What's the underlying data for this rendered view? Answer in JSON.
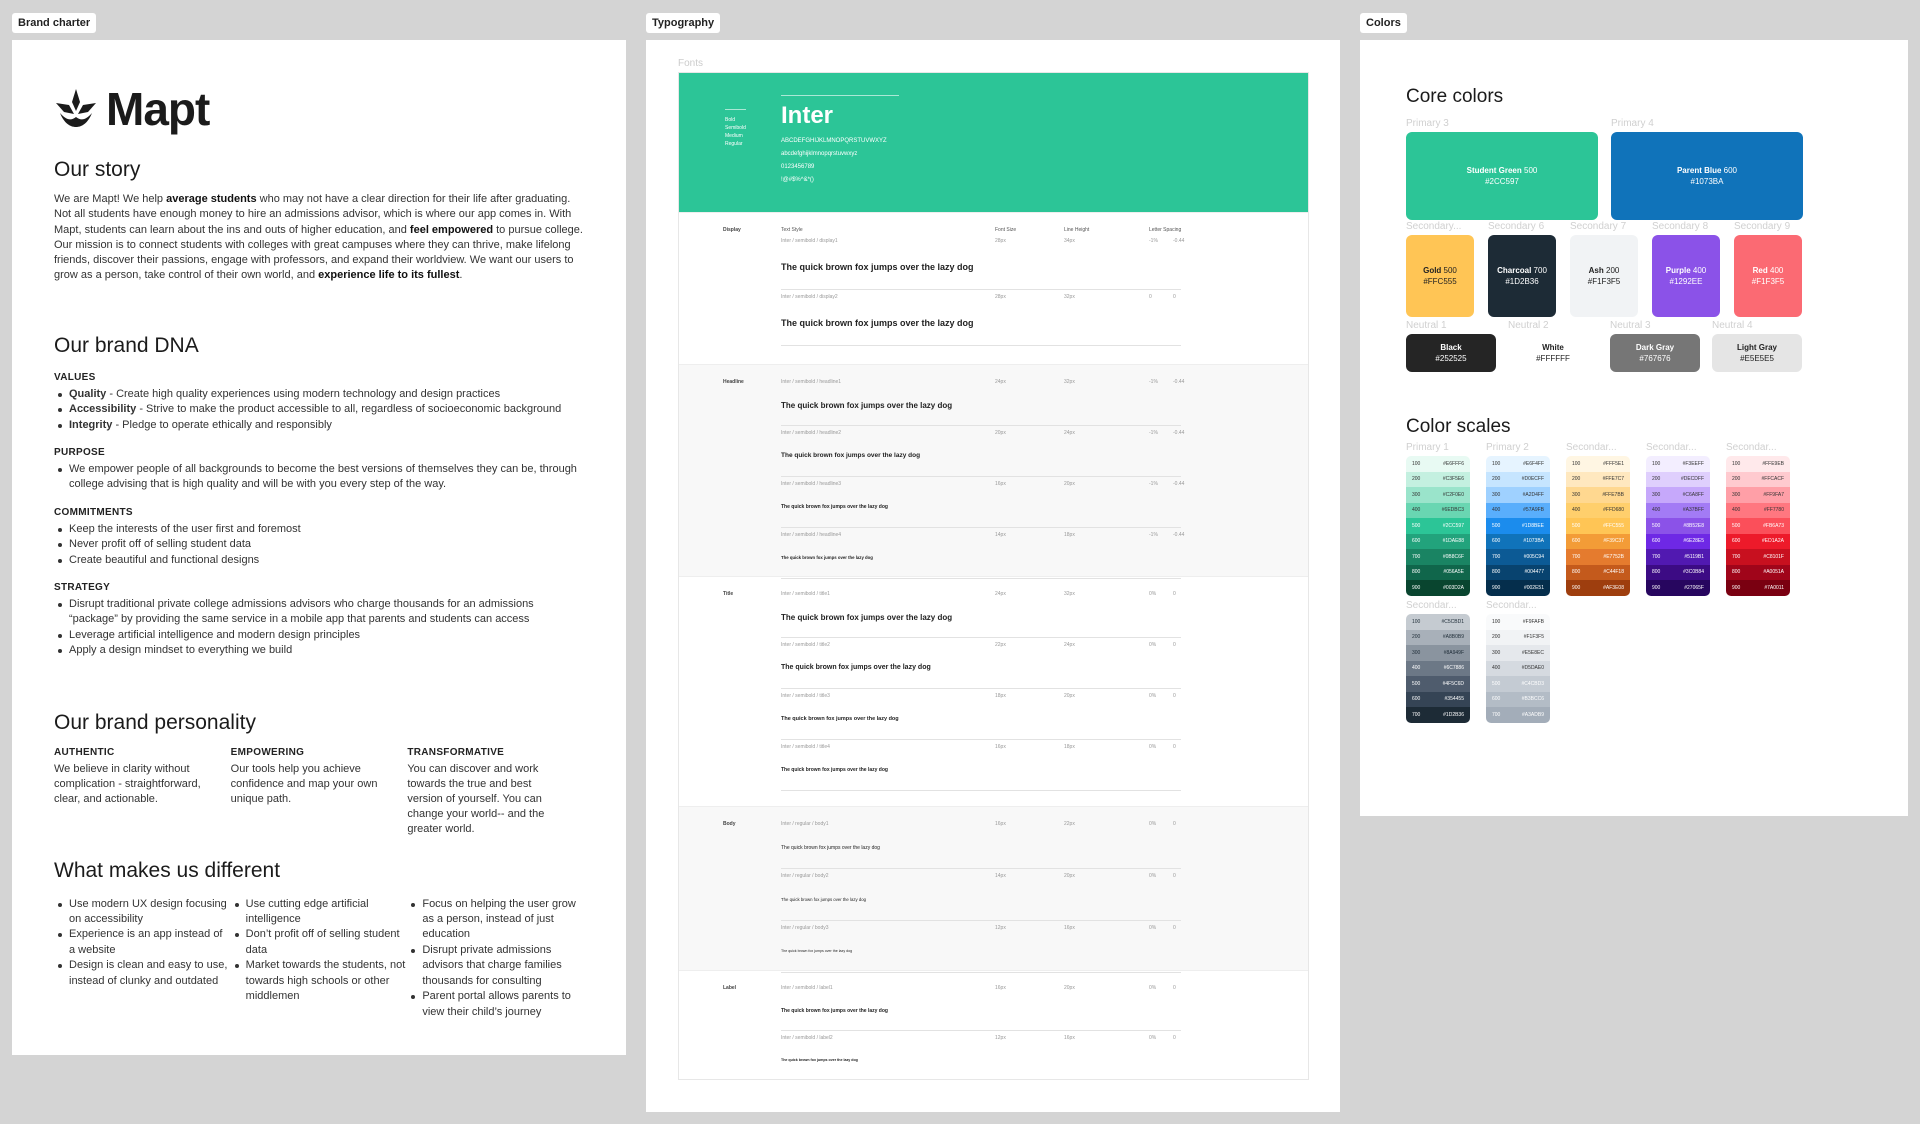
{
  "frames": {
    "brand": "Brand charter",
    "typography": "Typography",
    "colors": "Colors"
  },
  "brand": {
    "logo_text": "Mapt",
    "story_title": "Our story",
    "story_parts": [
      {
        "t": "We are Mapt! We help "
      },
      {
        "t": "average students",
        "b": true
      },
      {
        "t": " who may not have a clear direction for their life after graduating. Not all students have enough money to hire an admissions advisor, which is where our app comes in. With Mapt, students can learn about the ins and outs of higher education, and "
      },
      {
        "t": "feel empowered",
        "b": true
      },
      {
        "t": " to pursue college. Our mission is to connect students with colleges with great campuses where they can thrive, make lifelong friends, discover their passions, engage with professors, and expand their worldview. We want our users to grow as a person, take control of their own world, and "
      },
      {
        "t": "experience life to its fullest",
        "b": true
      },
      {
        "t": "."
      }
    ],
    "dna_title": "Our brand DNA",
    "values_title": "VALUES",
    "values": [
      {
        "k": "Quality",
        "v": " - Create high quality experiences using modern technology and design practices"
      },
      {
        "k": "Accessibility",
        "v": " - Strive to make the product accessible to all, regardless of socioeconomic background"
      },
      {
        "k": "Integrity",
        "v": " - Pledge to operate ethically and responsibly"
      }
    ],
    "purpose_title": "PURPOSE",
    "purpose": [
      "We empower people of all backgrounds to become the best versions of themselves they can be, through college advising that is high quality and will be with you every step of the way."
    ],
    "commit_title": "COMMITMENTS",
    "commitments": [
      "Keep the interests of the user first and foremost",
      "Never profit off of selling student data",
      "Create beautiful and functional designs"
    ],
    "strategy_title": "STRATEGY",
    "strategy": [
      "Disrupt traditional private college admissions advisors who charge thousands for an admissions “package” by providing the same service in a mobile app that parents and students can access",
      "Leverage artificial intelligence and modern design principles",
      "Apply a design mindset to everything we build"
    ],
    "personality_title": "Our brand personality",
    "personality": [
      {
        "h": "AUTHENTIC",
        "t": "We believe in clarity without complication - straightforward, clear, and actionable."
      },
      {
        "h": "EMPOWERING",
        "t": "Our tools help you achieve confidence and map your own unique path."
      },
      {
        "h": "TRANSFORMATIVE",
        "t": "You can discover and work towards the true and best version of yourself. You can change your world-- and the greater world."
      }
    ],
    "different_title": "What makes us different",
    "different": [
      [
        "Use modern UX design focusing on accessibility",
        "Experience is an app instead of a website",
        "Design is clean and easy to use, instead of clunky and outdated"
      ],
      [
        "Use cutting edge artificial intelligence",
        "Don’t profit off of selling student data",
        "Market towards the students, not towards high schools or other middlemen"
      ],
      [
        "Focus on helping the user grow as a person, instead of just education",
        "Disrupt private admissions advisors that charge families thousands for consulting",
        "Parent portal allows parents to view their child’s journey"
      ]
    ]
  },
  "typography": {
    "fonts_label": "Fonts",
    "weights": [
      "Bold",
      "Semibold",
      "Medium",
      "Regular"
    ],
    "font_name": "Inter",
    "glyphs": [
      "ABCDEFGHIJKLMNOPQRSTUVWXYZ",
      "abcdefghijklmnopqrstuvwxyz",
      "0123456789",
      "!@#$%^&*()"
    ],
    "columns": [
      "Text Style",
      "Font Size",
      "Line Height",
      "Letter Spacing"
    ],
    "sample": "The quick brown fox jumps over the lazy dog",
    "sections": [
      {
        "name": "Display",
        "rows": [
          {
            "style": "Inter / semibold / display1",
            "size": "28px",
            "lh": "34px",
            "ls": "-1%",
            "ls2": "-0.44"
          },
          {
            "style": "Inter / semibold / display2",
            "size": "28px",
            "lh": "32px",
            "ls": "0",
            "ls2": "0"
          }
        ]
      },
      {
        "name": "Headline",
        "rows": [
          {
            "style": "Inter / semibold / headline1",
            "size": "24px",
            "lh": "32px",
            "ls": "-1%",
            "ls2": "-0.44"
          },
          {
            "style": "Inter / semibold / headline2",
            "size": "20px",
            "lh": "24px",
            "ls": "-1%",
            "ls2": "-0.44"
          },
          {
            "style": "Inter / semibold / headline3",
            "size": "16px",
            "lh": "20px",
            "ls": "-1%",
            "ls2": "-0.44"
          },
          {
            "style": "Inter / semibold / headline4",
            "size": "14px",
            "lh": "18px",
            "ls": "-1%",
            "ls2": "-0.44"
          }
        ]
      },
      {
        "name": "Title",
        "rows": [
          {
            "style": "Inter / semibold / title1",
            "size": "24px",
            "lh": "32px",
            "ls": "0%",
            "ls2": "0"
          },
          {
            "style": "Inter / semibold / title2",
            "size": "22px",
            "lh": "24px",
            "ls": "0%",
            "ls2": "0"
          },
          {
            "style": "Inter / semibold / title3",
            "size": "18px",
            "lh": "20px",
            "ls": "0%",
            "ls2": "0"
          },
          {
            "style": "Inter / semibold / title4",
            "size": "16px",
            "lh": "18px",
            "ls": "0%",
            "ls2": "0"
          }
        ]
      },
      {
        "name": "Body",
        "rows": [
          {
            "style": "Inter / regular / body1",
            "size": "16px",
            "lh": "22px",
            "ls": "0%",
            "ls2": "0"
          },
          {
            "style": "Inter / regular / body2",
            "size": "14px",
            "lh": "20px",
            "ls": "0%",
            "ls2": "0"
          },
          {
            "style": "Inter / regular / body3",
            "size": "12px",
            "lh": "16px",
            "ls": "0%",
            "ls2": "0"
          }
        ]
      },
      {
        "name": "Label",
        "rows": [
          {
            "style": "Inter / semibold / label1",
            "size": "16px",
            "lh": "20px",
            "ls": "0%",
            "ls2": "0"
          },
          {
            "style": "Inter / semibold / label2",
            "size": "12px",
            "lh": "16px",
            "ls": "0%",
            "ls2": "0"
          }
        ]
      }
    ]
  },
  "colors": {
    "core_title": "Core colors",
    "primary": [
      {
        "label": "Primary 3",
        "name": "Student Green",
        "w": "500",
        "hex": "#2CC597",
        "bg": "#2cc597",
        "fg": "#ffffff"
      },
      {
        "label": "Primary 4",
        "name": "Parent Blue",
        "w": "600",
        "hex": "#1073BA",
        "bg": "#1073ba",
        "fg": "#ffffff"
      }
    ],
    "secondary": [
      {
        "label": "Secondary...",
        "name": "Gold",
        "w": "500",
        "hex": "#FFC555",
        "bg": "#ffc555",
        "fg": "#222222"
      },
      {
        "label": "Secondary 6",
        "name": "Charcoal",
        "w": "700",
        "hex": "#1D2B36",
        "bg": "#1d2b36",
        "fg": "#ffffff"
      },
      {
        "label": "Secondary 7",
        "name": "Ash",
        "w": "200",
        "hex": "#F1F3F5",
        "bg": "#f1f3f5",
        "fg": "#222222"
      },
      {
        "label": "Secondary 8",
        "name": "Purple",
        "w": "400",
        "hex": "#1292EE",
        "bg": "#8b52e8",
        "fg": "#ffffff"
      },
      {
        "label": "Secondary 9",
        "name": "Red",
        "w": "400",
        "hex": "#F1F3F5",
        "bg": "#fb6a73",
        "fg": "#ffffff"
      }
    ],
    "neutral": [
      {
        "label": "Neutral 1",
        "name": "Black",
        "hex": "#252525",
        "bg": "#252525",
        "fg": "#ffffff"
      },
      {
        "label": "Neutral 2",
        "name": "White",
        "hex": "#FFFFFF",
        "bg": "#ffffff",
        "fg": "#222222"
      },
      {
        "label": "Neutral 3",
        "name": "Dark Gray",
        "hex": "#767676",
        "bg": "#767676",
        "fg": "#ffffff"
      },
      {
        "label": "Neutral 4",
        "name": "Light Gray",
        "hex": "#E5E5E5",
        "bg": "#e5e5e5",
        "fg": "#222222"
      }
    ],
    "scales_title": "Color scales",
    "scales": [
      {
        "label": "Primary 1",
        "steps": [
          [
            "100",
            "#E6FFF6",
            "#e8faf3"
          ],
          [
            "200",
            "#C3F5E6",
            "#c4f0e0"
          ],
          [
            "300",
            "#C2F0E0",
            "#9ae4cb"
          ],
          [
            "400",
            "#6EDBC3",
            "#69d6b2"
          ],
          [
            "500",
            "#2CC597",
            "#2cc597"
          ],
          [
            "600",
            "#1DAE88",
            "#22a37c"
          ],
          [
            "700",
            "#0B8C6F",
            "#1a8463"
          ],
          [
            "800",
            "#056A5E",
            "#10664b"
          ],
          [
            "900",
            "#003D2A",
            "#09452f"
          ]
        ]
      },
      {
        "label": "Primary 2",
        "steps": [
          [
            "100",
            "#E6F4FF",
            "#e6f4ff"
          ],
          [
            "200",
            "#D0ECFF",
            "#c6e5ff"
          ],
          [
            "300",
            "#A2D4FF",
            "#9fd1ff"
          ],
          [
            "400",
            "#57A9FB",
            "#59aefc"
          ],
          [
            "500",
            "#1D8BEE",
            "#1b8ced"
          ],
          [
            "600",
            "#1073BA",
            "#1073ba"
          ],
          [
            "700",
            "#005C94",
            "#0c5a95"
          ],
          [
            "800",
            "#004477",
            "#08436f"
          ],
          [
            "900",
            "#002E51",
            "#052e4c"
          ]
        ]
      },
      {
        "label": "Secondar...",
        "steps": [
          [
            "100",
            "#FFF5E1",
            "#fff6e3"
          ],
          [
            "200",
            "#FFE7C7",
            "#ffe8bf"
          ],
          [
            "300",
            "#FFE7BB",
            "#ffd890"
          ],
          [
            "400",
            "#FFD680",
            "#ffcf6c"
          ],
          [
            "500",
            "#FFC555",
            "#ffc555"
          ],
          [
            "600",
            "#F39C37",
            "#f39c37"
          ],
          [
            "700",
            "#E7752B",
            "#e57b2e"
          ],
          [
            "800",
            "#C44F18",
            "#c45a1c"
          ],
          [
            "900",
            "#AF3E08",
            "#9e3e0e"
          ]
        ]
      },
      {
        "label": "Secondar...",
        "steps": [
          [
            "100",
            "#F3EEFF",
            "#f3eeff"
          ],
          [
            "200",
            "#DECDFF",
            "#dfcffd"
          ],
          [
            "300",
            "#C6A8FF",
            "#c6a8fb"
          ],
          [
            "400",
            "#A37BFF",
            "#a37bf5"
          ],
          [
            "500",
            "#8B52E8",
            "#8b52e8"
          ],
          [
            "600",
            "#6E28E5",
            "#6e28e5"
          ],
          [
            "700",
            "#5119B1",
            "#5119b1"
          ],
          [
            "800",
            "#3C0B84",
            "#3c0b84"
          ],
          [
            "900",
            "#27065F",
            "#27065f"
          ]
        ]
      },
      {
        "label": "Secondar...",
        "steps": [
          [
            "100",
            "#FFE9EB",
            "#ffe9eb"
          ],
          [
            "200",
            "#FFCACF",
            "#ffcacf"
          ],
          [
            "300",
            "#FF9FA7",
            "#ff9fa7"
          ],
          [
            "400",
            "#FF7780",
            "#ff7780"
          ],
          [
            "500",
            "#FB6A73",
            "#fb4f5a"
          ],
          [
            "600",
            "#ED1A2A",
            "#ed1a2a"
          ],
          [
            "700",
            "#C8101F",
            "#c8101f"
          ],
          [
            "800",
            "#A0051A",
            "#a0051a"
          ],
          [
            "900",
            "#7A0011",
            "#7a0011"
          ]
        ]
      },
      {
        "label": "Secondar...",
        "steps": [
          [
            "100",
            "#C5CBD1",
            "#c5cbd1"
          ],
          [
            "200",
            "#A8B0B9",
            "#a8b0b9"
          ],
          [
            "300",
            "#8A949F",
            "#8a949f"
          ],
          [
            "400",
            "#6C7886",
            "#6c7886"
          ],
          [
            "500",
            "#4F5C6D",
            "#4f5c6d"
          ],
          [
            "600",
            "#354455",
            "#354455"
          ],
          [
            "700",
            "#1D2B36",
            "#1d2b36"
          ]
        ]
      },
      {
        "label": "Secondar...",
        "steps": [
          [
            "100",
            "#F9FAFB",
            "#f9fafb"
          ],
          [
            "200",
            "#F1F3F5",
            "#f1f3f5"
          ],
          [
            "300",
            "#E5E8EC",
            "#e5e8ec"
          ],
          [
            "400",
            "#D5DAE0",
            "#d5dae0"
          ],
          [
            "500",
            "#C4CBD3",
            "#c4cbd3"
          ],
          [
            "600",
            "#B3BCC6",
            "#b3bcc6"
          ],
          [
            "700",
            "#A3ADB9",
            "#a3adb9"
          ]
        ]
      }
    ]
  }
}
